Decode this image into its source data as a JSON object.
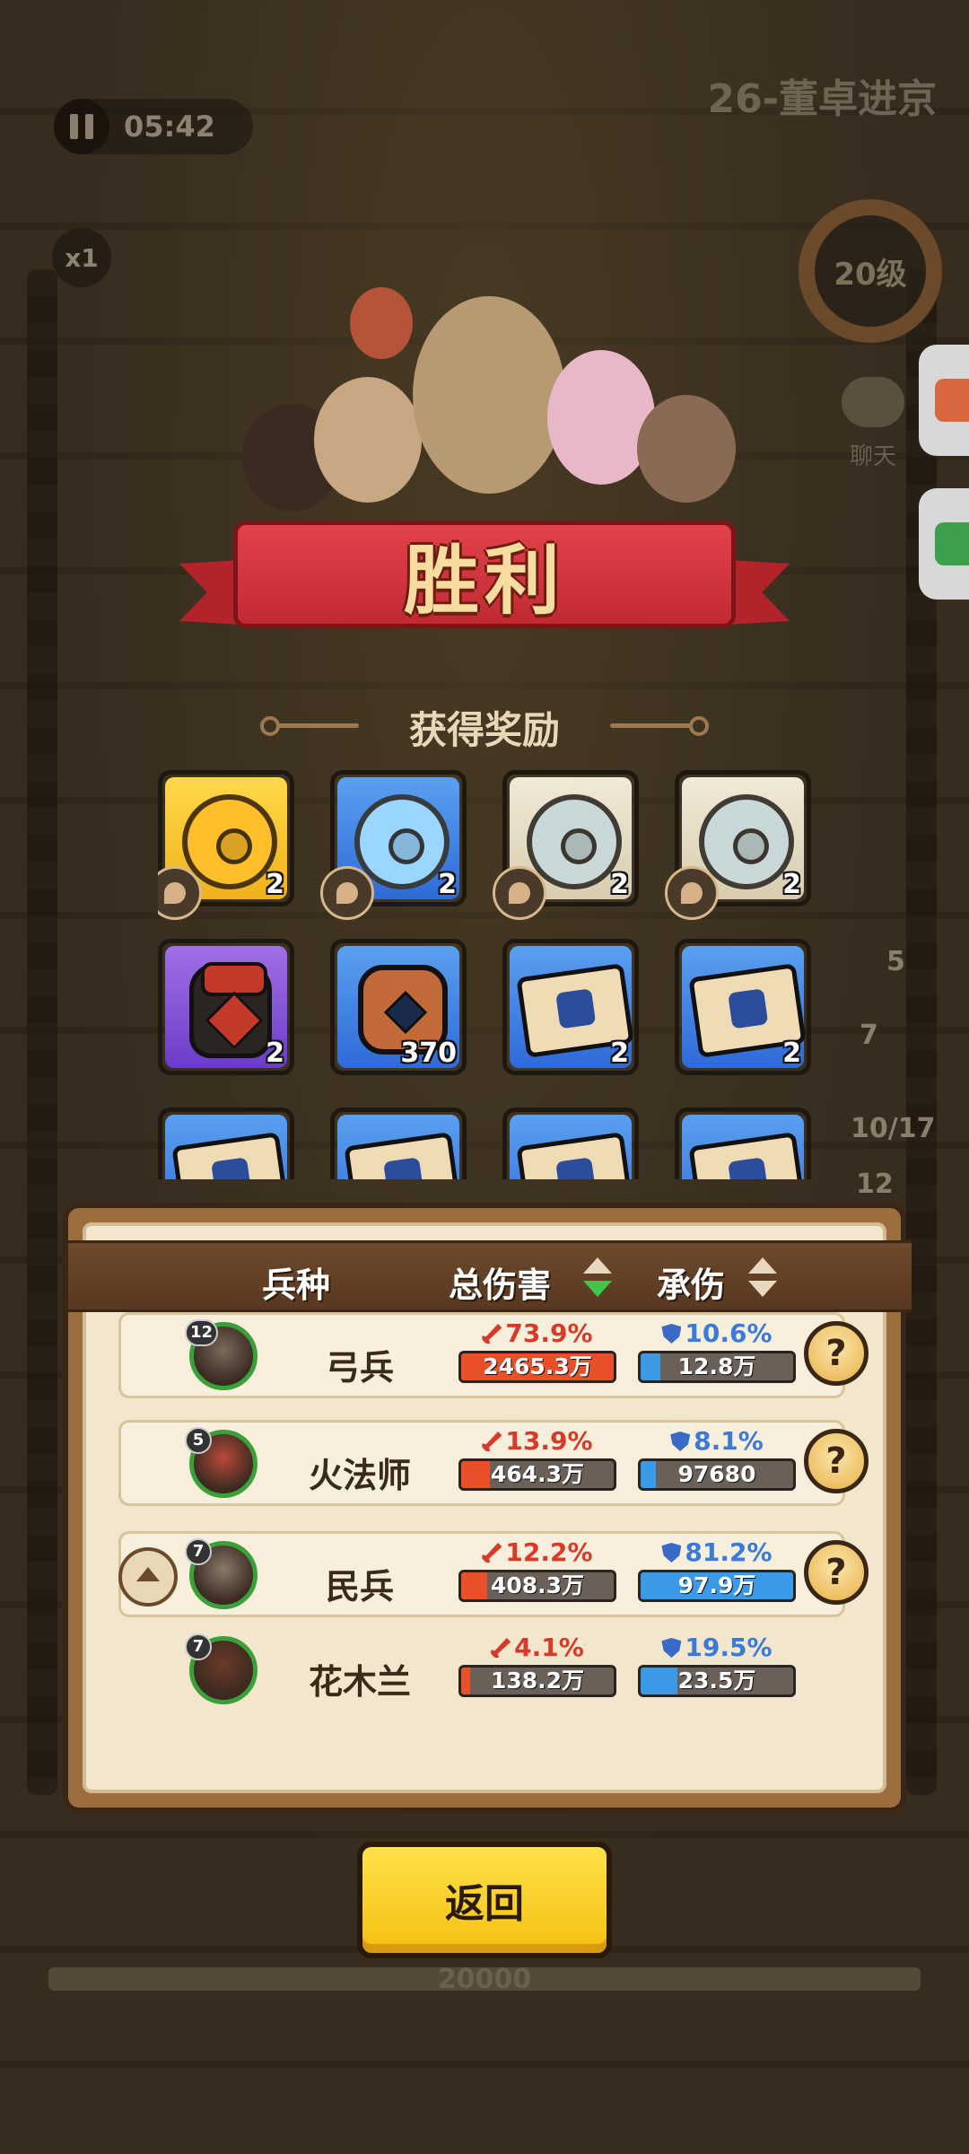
{
  "hud": {
    "timer": "05:42",
    "speed": "x1",
    "stage_title": "26-董卓进京",
    "level": "20级",
    "chat_label": "聊天",
    "side_numbers": [
      "5",
      "7",
      "10/17",
      "12"
    ],
    "hp_value": "20000"
  },
  "result": {
    "title": "胜利",
    "rewards_title": "获得奖励"
  },
  "rewards": [
    {
      "icon": "gold-stone-icon",
      "count": "2"
    },
    {
      "icon": "blue-stone-icon",
      "count": "2"
    },
    {
      "icon": "white-stone-icon",
      "count": "2"
    },
    {
      "icon": "white-stone-icon",
      "count": "2"
    },
    {
      "icon": "wine-jar-icon",
      "count": "2"
    },
    {
      "icon": "copper-coin-icon",
      "count": "370"
    },
    {
      "icon": "scroll-icon",
      "count": "2"
    },
    {
      "icon": "scroll-icon",
      "count": "2"
    }
  ],
  "stats": {
    "headers": {
      "unit": "兵种",
      "damage": "总伤害",
      "taken": "承伤"
    },
    "rows": [
      {
        "level": "12",
        "name": "弓兵",
        "dmg_pct": "73.9%",
        "dmg_val": "2465.3万",
        "dmg_fill": 1.0,
        "taken_pct": "10.6%",
        "taken_val": "12.8万",
        "taken_fill": 0.13
      },
      {
        "level": "5",
        "name": "火法师",
        "dmg_pct": "13.9%",
        "dmg_val": "464.3万",
        "dmg_fill": 0.19,
        "taken_pct": "8.1%",
        "taken_val": "97680",
        "taken_fill": 0.1
      },
      {
        "level": "7",
        "name": "民兵",
        "dmg_pct": "12.2%",
        "dmg_val": "408.3万",
        "dmg_fill": 0.17,
        "taken_pct": "81.2%",
        "taken_val": "97.9万",
        "taken_fill": 1.0
      },
      {
        "level": "7",
        "name": "花木兰",
        "dmg_pct": "4.1%",
        "dmg_val": "138.2万",
        "dmg_fill": 0.06,
        "taken_pct": "19.5%",
        "taken_val": "23.5万",
        "taken_fill": 0.24
      }
    ]
  },
  "buttons": {
    "return": "返回",
    "help": "?"
  }
}
